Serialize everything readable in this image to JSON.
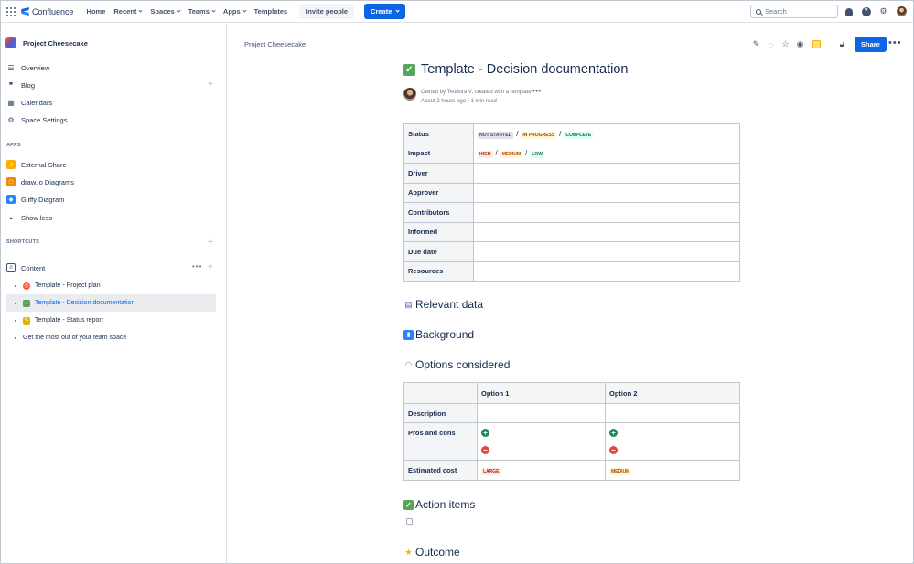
{
  "topbar": {
    "brand": "Confluence",
    "nav": [
      "Home",
      "Recent",
      "Spaces",
      "Teams",
      "Apps",
      "Templates"
    ],
    "invite": "Invite people",
    "create": "Create",
    "search_placeholder": "Search"
  },
  "sidebar": {
    "space_name": "Project Cheesecake",
    "main_items": [
      "Overview",
      "Blog",
      "Calendars",
      "Space Settings"
    ],
    "apps_heading": "APPS",
    "apps": [
      "External Share",
      "draw.io Diagrams",
      "Gliffy Diagram"
    ],
    "show_less": "Show less",
    "shortcuts_heading": "SHORTCUTS",
    "content_label": "Content",
    "tree": [
      "Template - Project plan",
      "Template - Decision documentation",
      "Template - Status report",
      "Get the most out of your team space"
    ]
  },
  "page": {
    "breadcrumb": "Project Cheesecake",
    "share": "Share",
    "title": "Template - Decision documentation",
    "byline1": "Owned by Teodora V, created with a template",
    "byline2": "About 2 hours ago • 1 min read",
    "props": {
      "status_label": "Status",
      "status_values": [
        "NOT STARTED",
        "IN PROGRESS",
        "COMPLETE"
      ],
      "impact_label": "Impact",
      "impact_values": [
        "HIGH",
        "MEDIUM",
        "LOW"
      ],
      "rows": [
        "Driver",
        "Approver",
        "Contributors",
        "Informed",
        "Due date",
        "Resources"
      ]
    },
    "headings": {
      "relevant": "Relevant data",
      "background": "Background",
      "options": "Options considered",
      "actions": "Action items",
      "outcome": "Outcome"
    },
    "options_table": {
      "col1": "Option 1",
      "col2": "Option 2",
      "description": "Description",
      "pros_cons": "Pros and cons",
      "cost": "Estimated cost",
      "cost1": "LARGE",
      "cost2": "MEDIUM"
    }
  },
  "colors": {
    "primary": "#0c66e4",
    "lozenge_grey": "#dfe1e6",
    "lozenge_blue_text": "#0055cc",
    "lozenge_red_bg": "#ffebe6",
    "lozenge_red_text": "#ae2a19",
    "lozenge_yellow_bg": "#fff7d6",
    "lozenge_yellow_text": "#a54800",
    "lozenge_green_bg": "#dcfff1",
    "lozenge_green_text": "#216e4e"
  }
}
